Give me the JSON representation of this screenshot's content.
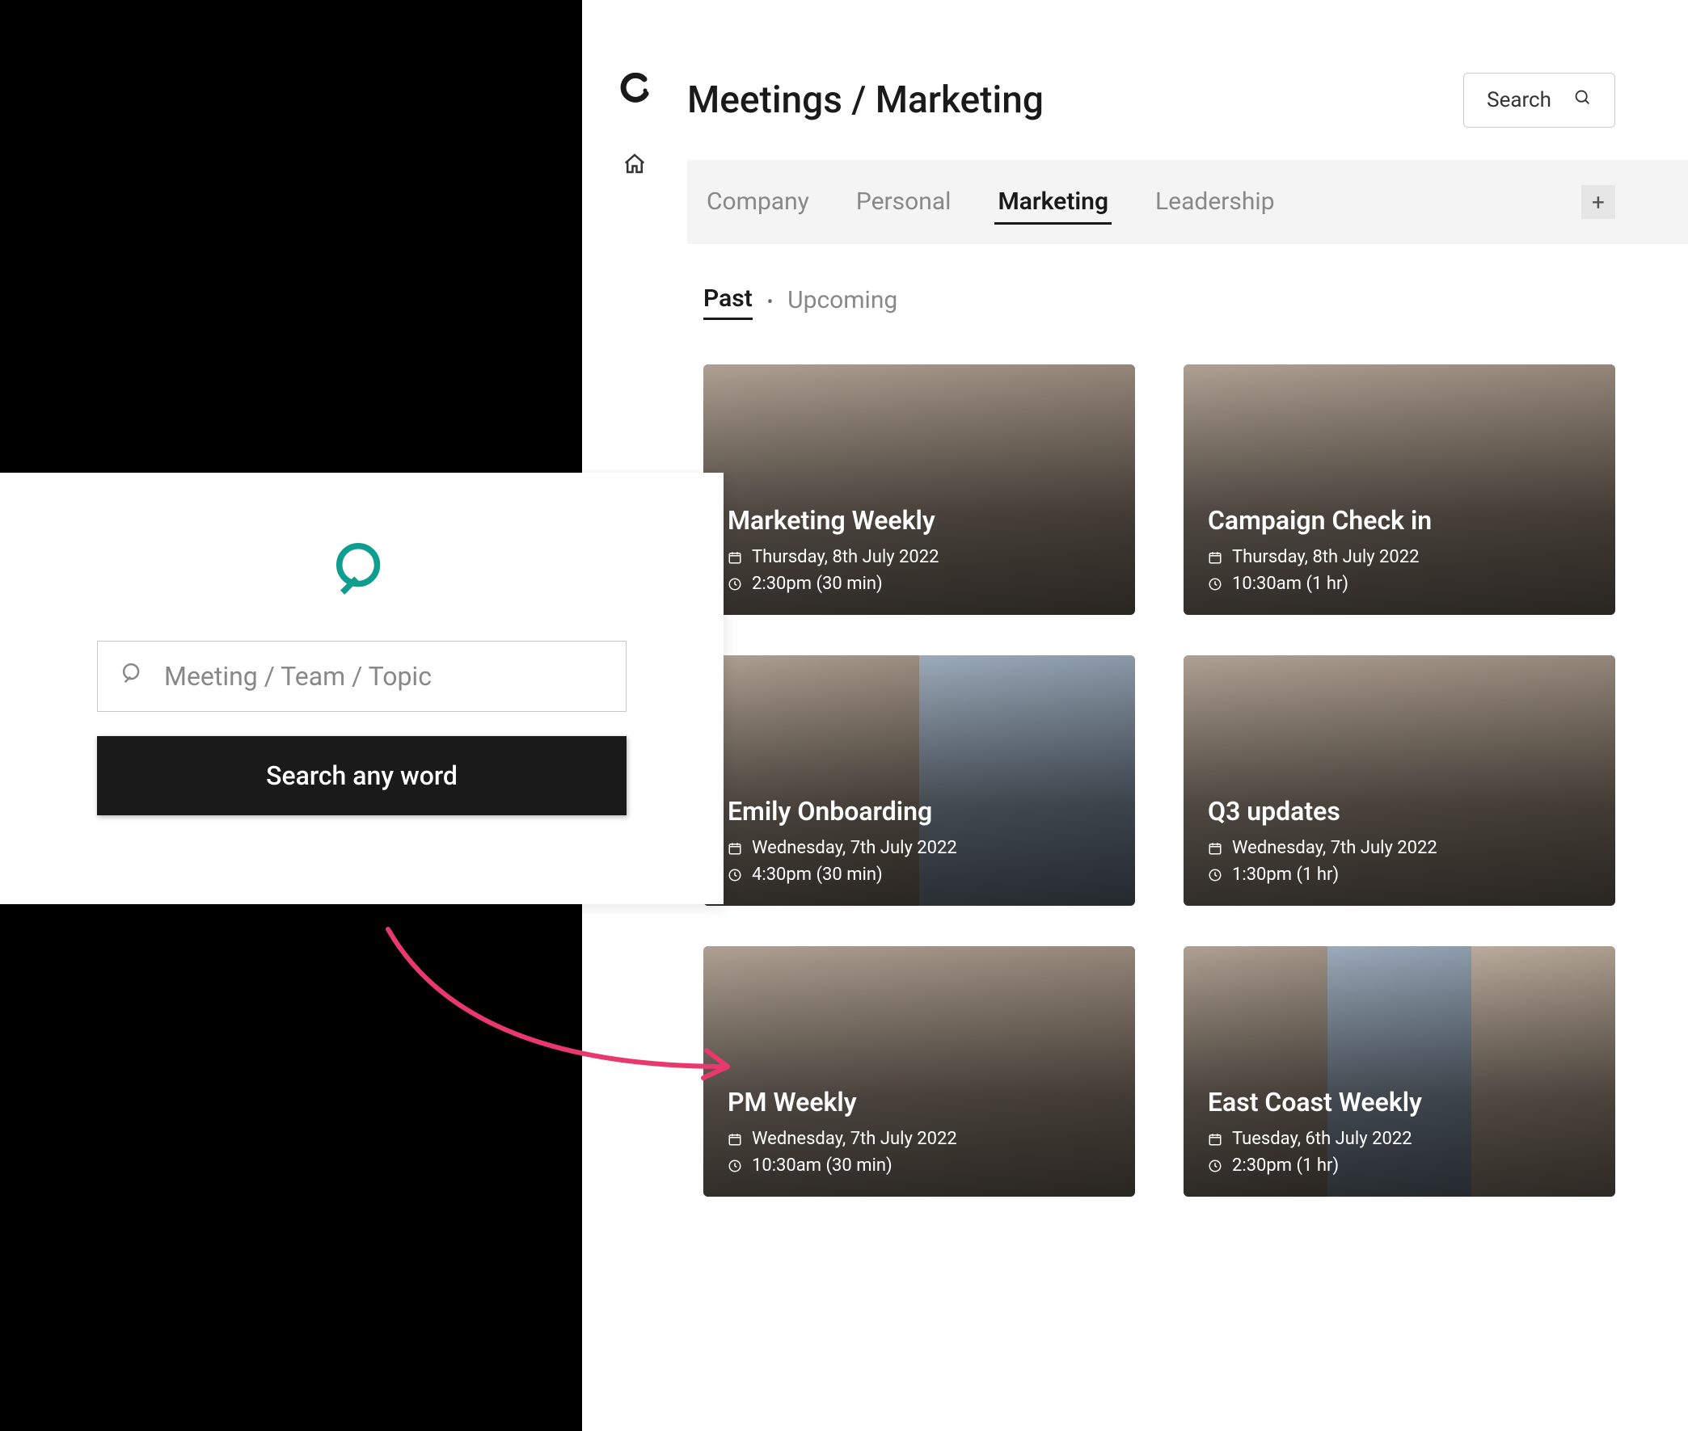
{
  "breadcrumb": "Meetings / Marketing",
  "search_label": "Search",
  "tabs": {
    "company": "Company",
    "personal": "Personal",
    "marketing": "Marketing",
    "leadership": "Leadership"
  },
  "add_glyph": "+",
  "filter": {
    "past": "Past",
    "upcoming": "Upcoming",
    "dot": "•"
  },
  "cards": {
    "c0": {
      "title": "Marketing Weekly",
      "date": "Thursday, 8th July 2022",
      "time": "2:30pm (30 min)"
    },
    "c1": {
      "title": "Campaign Check in",
      "date": "Thursday, 8th July 2022",
      "time": "10:30am (1 hr)"
    },
    "c2": {
      "title": "Emily Onboarding",
      "date": "Wednesday, 7th July 2022",
      "time": "4:30pm (30 min)"
    },
    "c3": {
      "title": "Q3 updates",
      "date": "Wednesday, 7th July 2022",
      "time": "1:30pm (1 hr)"
    },
    "c4": {
      "title": "PM Weekly",
      "date": "Wednesday, 7th July 2022",
      "time": "10:30am (30 min)"
    },
    "c5": {
      "title": "East Coast Weekly",
      "date": "Tuesday, 6th July 2022",
      "time": "2:30pm (1 hr)"
    }
  },
  "overlay": {
    "placeholder": "Meeting / Team / Topic",
    "button": "Search any word"
  }
}
